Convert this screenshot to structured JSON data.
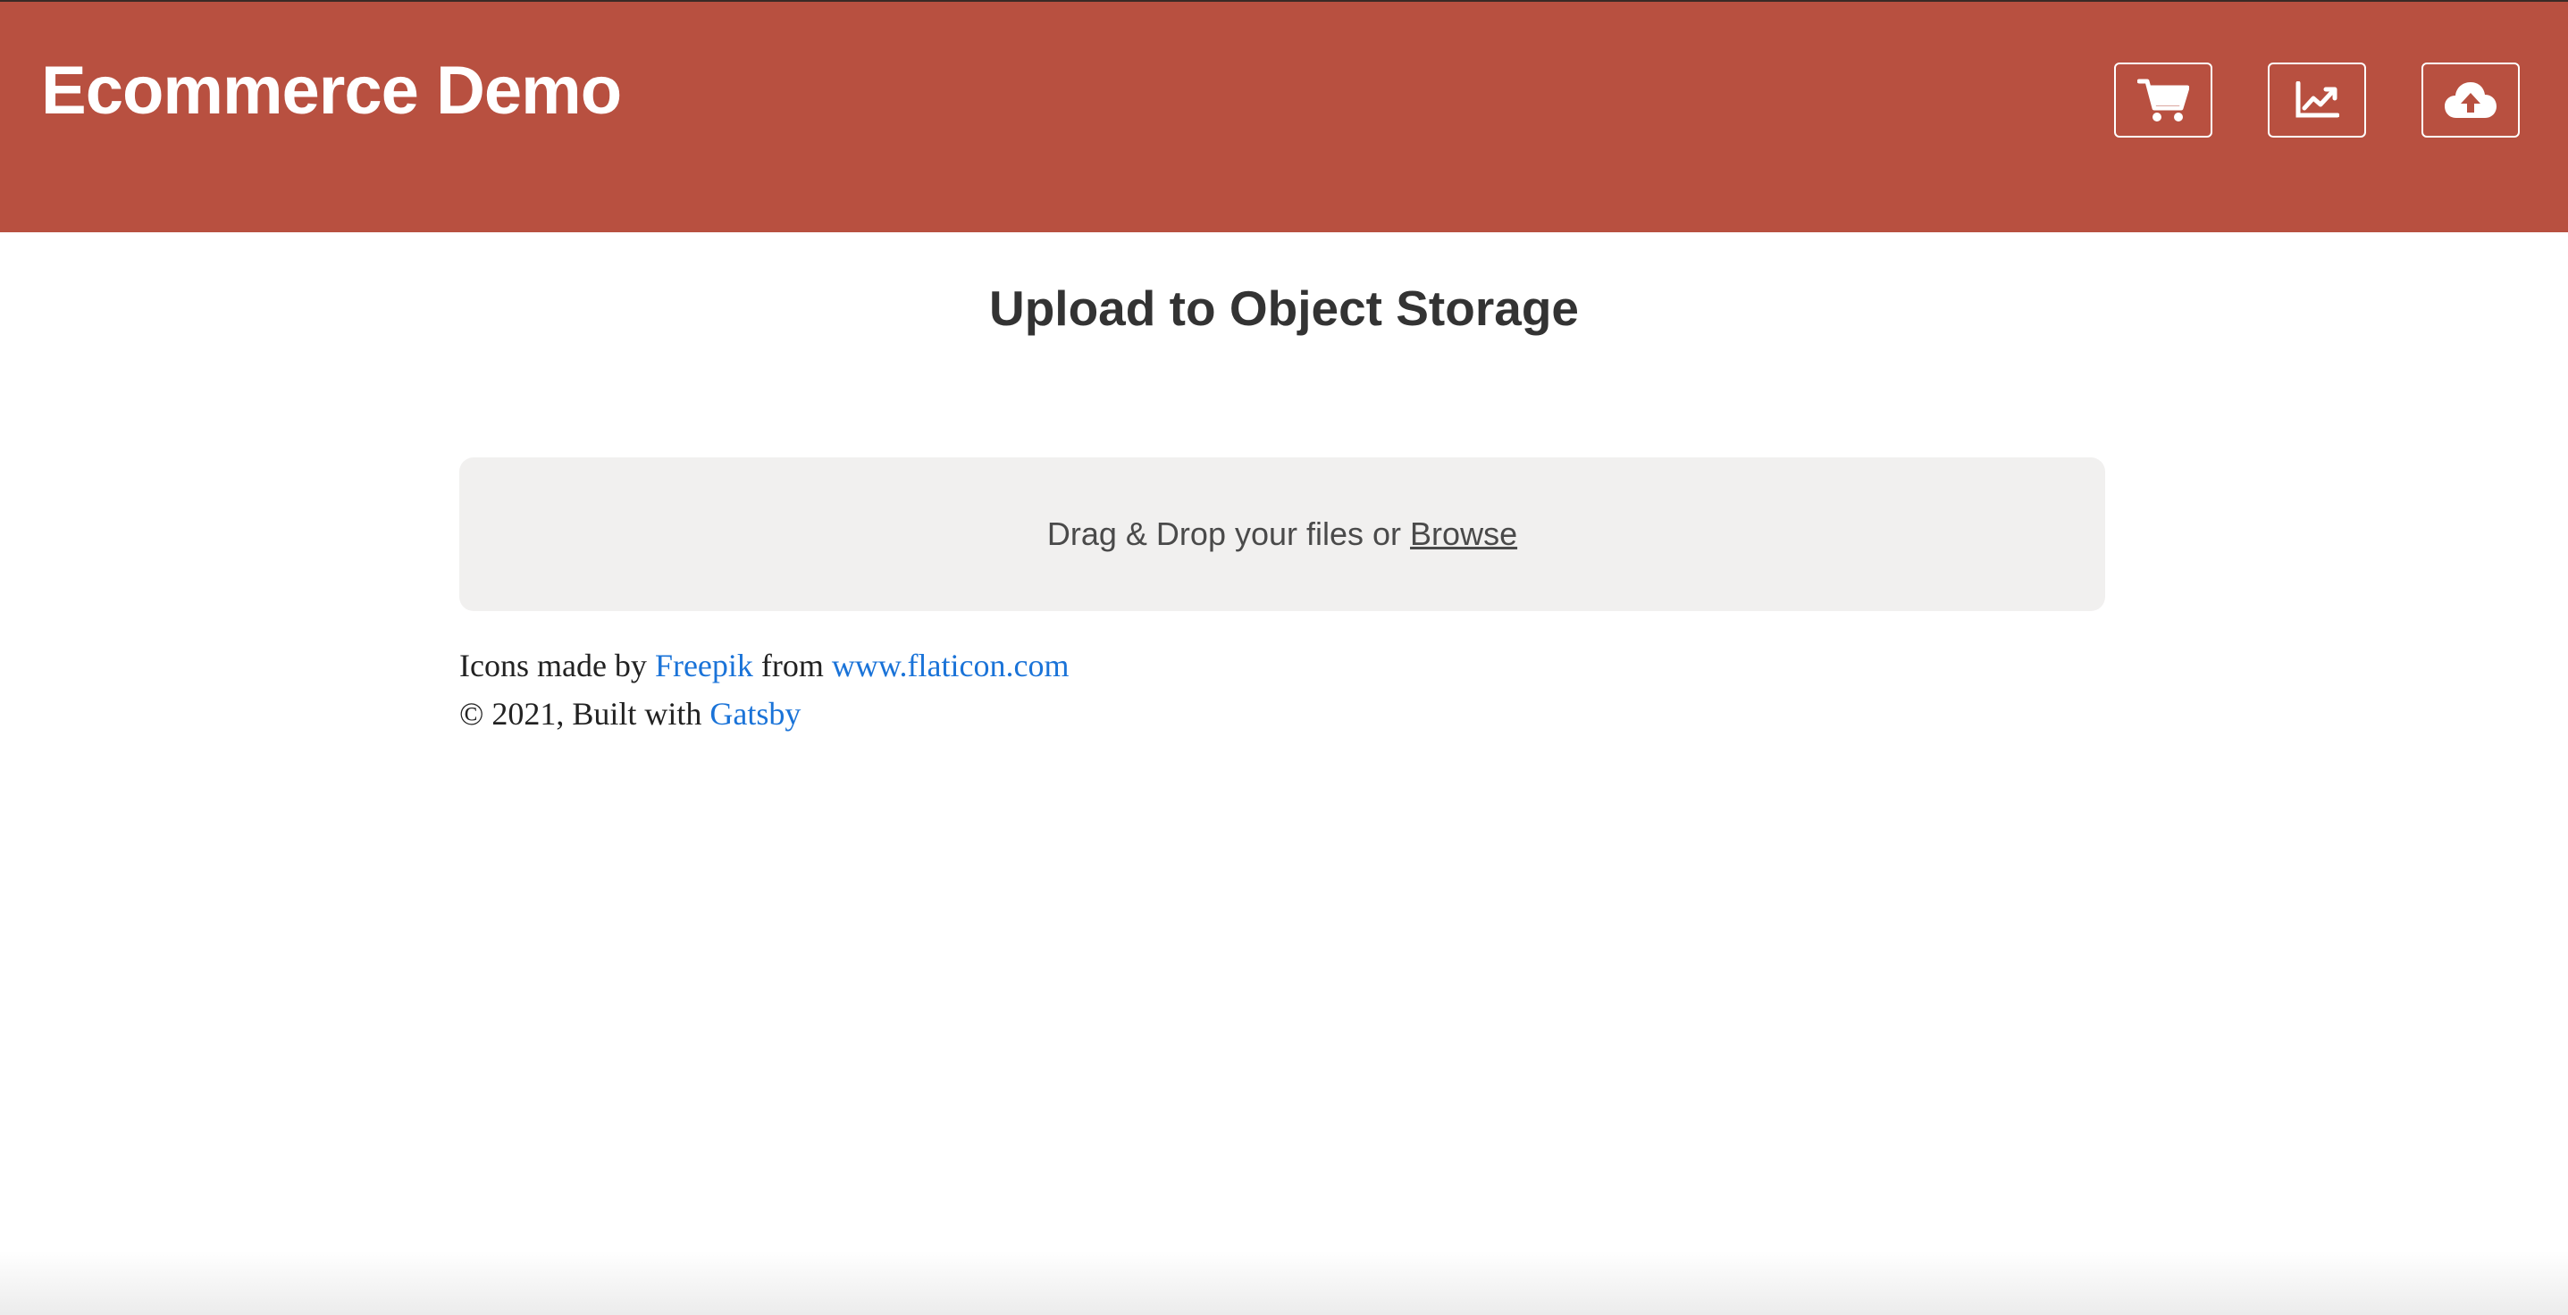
{
  "header": {
    "title": "Ecommerce Demo",
    "background_color": "#b85040",
    "buttons": [
      {
        "icon": "shopping-cart-icon"
      },
      {
        "icon": "line-chart-icon"
      },
      {
        "icon": "cloud-upload-icon"
      }
    ]
  },
  "main": {
    "title": "Upload to Object Storage",
    "dropzone": {
      "text": "Drag & Drop your files or",
      "browse_label": "Browse",
      "background_color": "#f1f0ef"
    }
  },
  "footer": {
    "credit_prefix": "Icons made by",
    "credit_author": "Freepik",
    "credit_middle": "from",
    "credit_site": "www.flaticon.com",
    "copyright_prefix": "© 2021, Built with",
    "copyright_link": "Gatsby",
    "link_color": "#1a73d8"
  }
}
